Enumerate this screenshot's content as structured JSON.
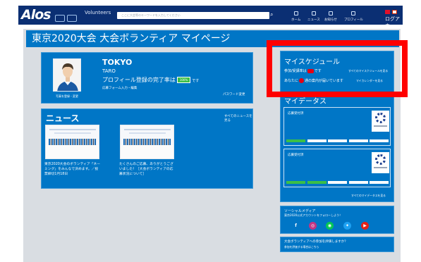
{
  "header": {
    "logo": "Alos",
    "brand": "Volunteers",
    "search_placeholder": "ここに大会等のキーワードを入力してください",
    "search_icon": "search-icon",
    "nav": [
      "ホーム",
      "ニュース",
      "お知らせ",
      "プロフィール"
    ],
    "lang_label": "ログアウ"
  },
  "page": {
    "title": "東京2020大会 大会ボランティア マイページ"
  },
  "profile": {
    "avatar_caption": "写真を登録・変更",
    "name": "TOKYO",
    "given_name": "TARO",
    "completion_message": "プロフィール登録の完了率は",
    "completion_percent": "100%",
    "completion_suffix": "です",
    "form_link": "応募フォーム入力・編集",
    "password_link": "パスワード変更"
  },
  "news": {
    "title": "ニュース",
    "see_all": "すべてのニュースを見る",
    "items": [
      {
        "caption": "東京2020大会のボランティア「ネーミング」をみんなで決めます。／投票締切1月18日"
      },
      {
        "caption": "たくさんのご応募、ありがとうございました！［大会ボランティアの応募状況について］"
      }
    ]
  },
  "schedule": {
    "title": "マイスケジュール",
    "row1_prefix": "参加/受講率は",
    "row1_suffix": "です",
    "row1_link": "すべてのマイスケジュールを見る",
    "row2_prefix": "あなたに",
    "row2_suffix": "通の案内が届いています",
    "row2_link": "マイカレンダーを見る"
  },
  "datas": {
    "title": "マイデータス",
    "panels": [
      {
        "label": "応募受付済",
        "filled_segments": 1,
        "total_segments": 5
      },
      {
        "label": "応募受付済",
        "filled_segments": 2,
        "total_segments": 5
      }
    ],
    "see_all": "すべてのマイデータスを見る"
  },
  "social": {
    "title": "ソーシャルメディア",
    "subtitle": "東京2020公式アカウントをフォローしよう！",
    "icons": [
      "facebook-icon",
      "instagram-icon",
      "line-icon",
      "twitter-icon",
      "youtube-icon"
    ]
  },
  "evaluation": {
    "title": "大会ボランティアへの参加を評価しますか？",
    "link": "参加を評価する場合はこちら"
  },
  "colors": {
    "nav": "#0b2f73",
    "primary": "#0076c6",
    "accent_red": "#e60012",
    "accent_green": "#3bbf46",
    "highlight": "#ff0000"
  }
}
